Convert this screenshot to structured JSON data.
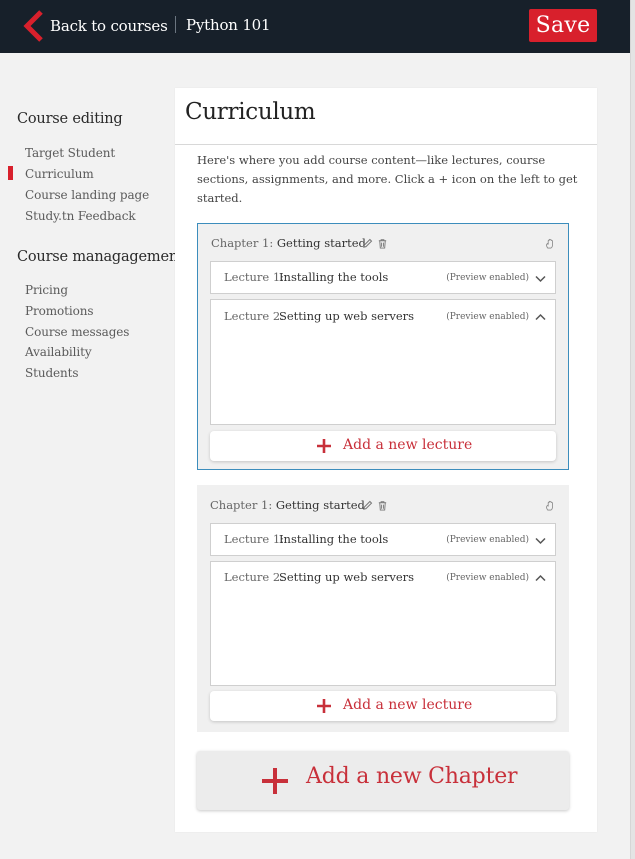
{
  "header": {
    "back_label": "Back to courses",
    "course_title": "Python 101",
    "save_label": "Save"
  },
  "sidebar": {
    "course_editing_heading": "Course editing",
    "course_editing_items": [
      {
        "label": "Target Student"
      },
      {
        "label": "Curriculum",
        "active": true
      },
      {
        "label": "Course landing page"
      },
      {
        "label": "Study.tn Feedback"
      }
    ],
    "course_management_heading": "Course managagement",
    "course_management_items": [
      {
        "label": "Pricing"
      },
      {
        "label": "Promotions"
      },
      {
        "label": "Course messages"
      },
      {
        "label": "Availability"
      },
      {
        "label": "Students"
      }
    ]
  },
  "main": {
    "title": "Curriculum",
    "intro": "Here's where you add course content—like lectures, course sections, assignments, and more. Click a + icon on the left to get started.",
    "chapters": [
      {
        "label": "Chapter 1:",
        "name": "Getting started",
        "active": true,
        "lectures": [
          {
            "label": "Lecture 1:",
            "name": "Installing the tools",
            "preview": "(Preview enabled)",
            "expanded": false
          },
          {
            "label": "Lecture 2:",
            "name": "Setting up web servers",
            "preview": "(Preview enabled)",
            "expanded": true
          }
        ],
        "add_lecture_label": "Add a new lecture"
      },
      {
        "label": "Chapter 1:",
        "name": "Getting started",
        "active": false,
        "lectures": [
          {
            "label": "Lecture 1:",
            "name": "Installing the tools",
            "preview": "(Preview enabled)",
            "expanded": false
          },
          {
            "label": "Lecture 2:",
            "name": "Setting up web servers",
            "preview": "(Preview enabled)",
            "expanded": true
          }
        ],
        "add_lecture_label": "Add a new lecture"
      }
    ],
    "add_chapter_label": "Add a new Chapter"
  },
  "colors": {
    "brand_red": "#d8202c",
    "accent_red_text": "#c8303a",
    "topbar_bg": "#17202a",
    "active_border": "#3c8dbc"
  }
}
